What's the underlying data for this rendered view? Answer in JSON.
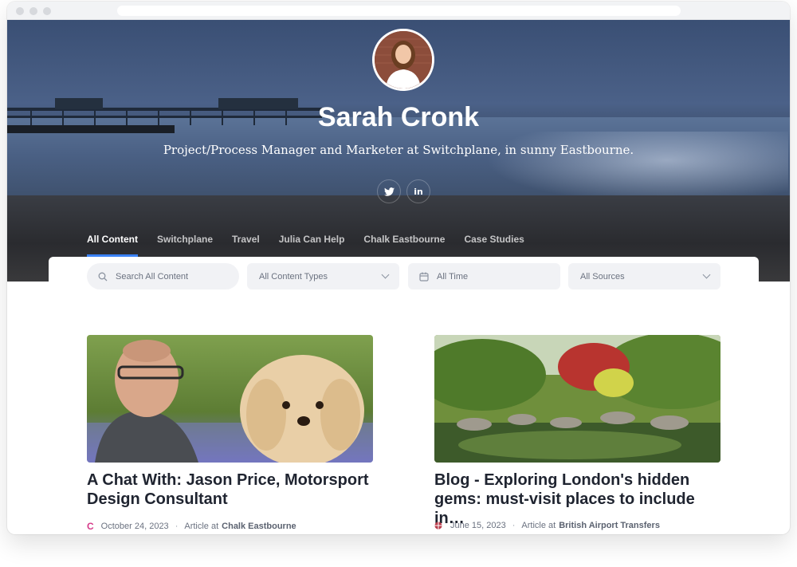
{
  "profile": {
    "name": "Sarah Cronk",
    "tagline": "Project/Process Manager and Marketer at Switchplane, in sunny Eastbourne."
  },
  "social": [
    {
      "icon": "twitter-icon"
    },
    {
      "icon": "linkedin-icon",
      "glyph": "in"
    }
  ],
  "tabs": [
    {
      "label": "All Content",
      "active": true
    },
    {
      "label": "Switchplane",
      "active": false
    },
    {
      "label": "Travel",
      "active": false
    },
    {
      "label": "Julia Can Help",
      "active": false
    },
    {
      "label": "Chalk Eastbourne",
      "active": false
    },
    {
      "label": "Case Studies",
      "active": false
    }
  ],
  "filters": {
    "search_placeholder": "Search All Content",
    "content_types": "All Content Types",
    "time": "All Time",
    "sources": "All Sources"
  },
  "cards": [
    {
      "title": "A Chat With: Jason Price, Motorsport Design Consultant",
      "date": "October 24, 2023",
      "type": "Article at",
      "source": "Chalk Eastbourne",
      "source_icon_letter": "C"
    },
    {
      "title": "Blog - Exploring London's hidden gems: must-visit places to include in…",
      "date": "June 15, 2023",
      "type": "Article at",
      "source": "British Airport Transfers"
    }
  ],
  "colors": {
    "accent": "#3b82f6",
    "chalk_brand": "#d63b8a"
  }
}
